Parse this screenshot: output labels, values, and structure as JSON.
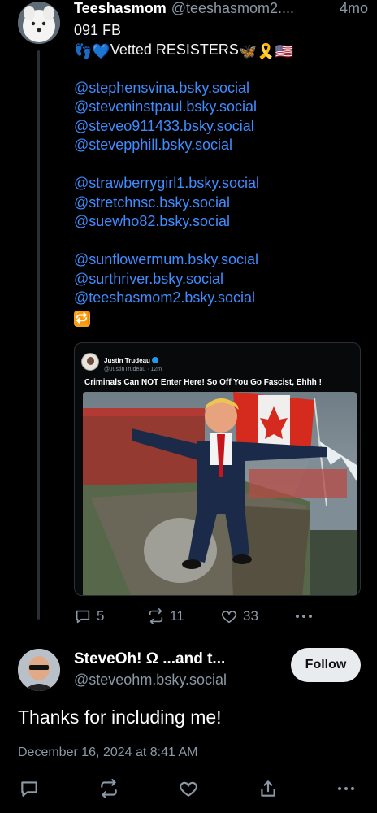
{
  "parent_post": {
    "display_name": "Teeshasmom",
    "handle": "@teeshasmom2....",
    "time": "4mo",
    "text_line1": "091 FB",
    "text_line2_prefix_emoji": "👣💙",
    "text_line2": "Vetted RESISTERS",
    "text_line2_suffix_emoji": "🦋🎗️🇺🇸",
    "mention_groups": [
      [
        "@stephensvina.bsky.social",
        "@steveninstpaul.bsky.social",
        "@steveo911433.bsky.social",
        "@stevepphill.bsky.social"
      ],
      [
        "@strawberrygirl1.bsky.social",
        "@stretchnsc.bsky.social",
        "@suewho82.bsky.social"
      ],
      [
        "@sunflowermum.bsky.social",
        "@surthriver.bsky.social",
        "@teeshasmom2.bsky.social"
      ]
    ],
    "trailing_emoji": "🔁",
    "embed": {
      "author_name": "Justin Trudeau",
      "author_handle": "@JustinTrudeau · 12m",
      "text": "Criminals Can NOT Enter Here!  So Off You Go Fascist, Ehhh !"
    },
    "stats": {
      "replies": "5",
      "reposts": "11",
      "likes": "33"
    }
  },
  "reply_post": {
    "display_name": "SteveOh! Ω ...and t...",
    "handle": "@steveohm.bsky.social",
    "follow_label": "Follow",
    "text": "Thanks for including me!",
    "date": "December 16, 2024 at 8:41 AM"
  },
  "icons": {
    "reply": "reply-icon",
    "repost": "repost-icon",
    "like": "heart-icon",
    "more": "more-icon",
    "share": "share-icon"
  },
  "colors": {
    "background": "#000000",
    "mention": "#3f8cff",
    "muted": "#8b98a5",
    "follow_bg": "#e9ecef"
  }
}
